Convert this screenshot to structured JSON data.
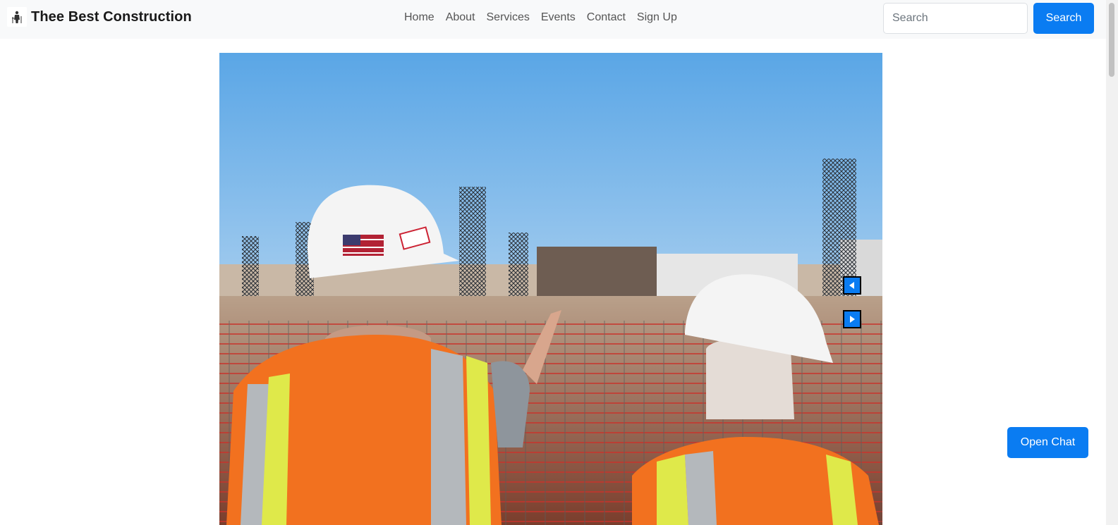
{
  "brand": {
    "name": "Thee Best Construction",
    "logo": "construction-worker-icon"
  },
  "nav": {
    "items": [
      "Home",
      "About",
      "Services",
      "Events",
      "Contact",
      "Sign Up"
    ]
  },
  "search": {
    "placeholder": "Search",
    "button_label": "Search"
  },
  "carousel": {
    "prev_icon": "triangle-left-icon",
    "next_icon": "triangle-right-icon"
  },
  "chat": {
    "button_label": "Open Chat"
  },
  "colors": {
    "primary": "#0a7cf2",
    "navbar_bg": "#f8f9fa",
    "nav_text": "#555555",
    "sky_top": "#5aa6e6",
    "vest_orange": "#f2711f"
  }
}
